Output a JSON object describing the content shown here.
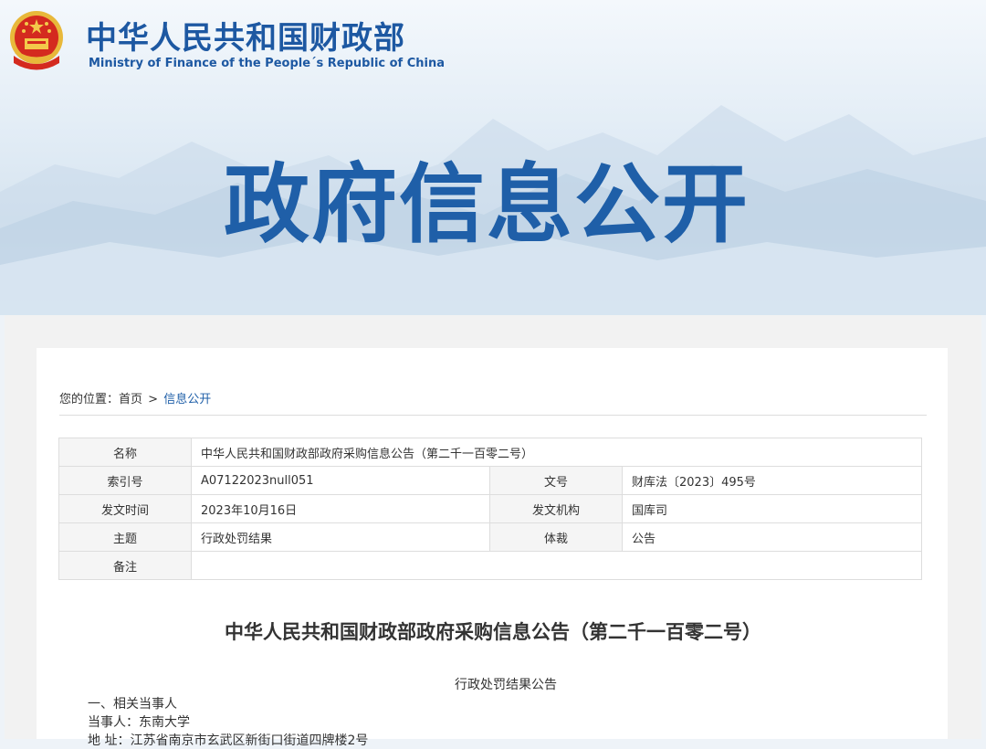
{
  "header": {
    "ministry_cn": "中华人民共和国财政部",
    "ministry_en": "Ministry of Finance of the People´s Republic of China",
    "banner_title": "政府信息公开",
    "brand_color": "#1f5fa8"
  },
  "breadcrumb": {
    "prefix": "您的位置：",
    "home": "首页",
    "separator": ">",
    "current": "信息公开"
  },
  "meta_table": {
    "name_label": "名称",
    "name_value": "中华人民共和国财政部政府采购信息公告（第二千一百零二号）",
    "index_label": "索引号",
    "index_value": "A07122023null051",
    "docno_label": "文号",
    "docno_value": "财库法〔2023〕495号",
    "date_label": "发文时间",
    "date_value": "2023年10月16日",
    "org_label": "发文机构",
    "org_value": "国库司",
    "topic_label": "主题",
    "topic_value": "行政处罚结果",
    "genre_label": "体裁",
    "genre_value": "公告",
    "note_label": "备注",
    "note_value": ""
  },
  "article": {
    "title": "中华人民共和国财政部政府采购信息公告（第二千一百零二号）",
    "subtitle": "行政处罚结果公告",
    "lines": [
      "一、相关当事人",
      "当事人：东南大学",
      "地  址：江苏省南京市玄武区新街口街道四牌楼2号"
    ]
  }
}
